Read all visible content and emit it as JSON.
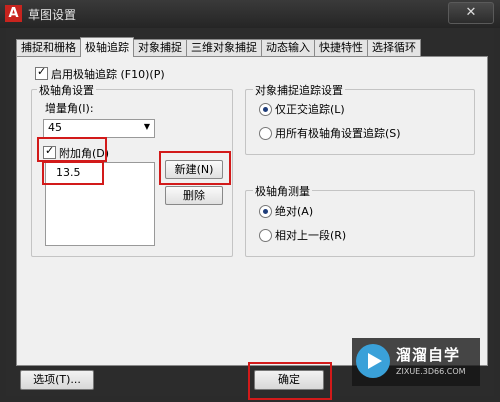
{
  "window": {
    "title": "草图设置",
    "logo_letter": "A",
    "close_label": "✕"
  },
  "tabs": [
    {
      "label": "捕捉和栅格"
    },
    {
      "label": "极轴追踪"
    },
    {
      "label": "对象捕捉"
    },
    {
      "label": "三维对象捕捉"
    },
    {
      "label": "动态输入"
    },
    {
      "label": "快捷特性"
    },
    {
      "label": "选择循环"
    }
  ],
  "active_tab": "极轴追踪",
  "enable_polar": {
    "label": "启用极轴追踪 (F10)(P)",
    "checked": true
  },
  "polar_settings": {
    "legend": "极轴角设置",
    "increment_label": "增量角(I):",
    "increment_value": "45",
    "additional_label": "附加角(D)",
    "additional_checked": true,
    "additional_angles": [
      "13.5"
    ],
    "new_button": "新建(N)",
    "delete_button": "删除"
  },
  "object_snap_tracking": {
    "legend": "对象捕捉追踪设置",
    "options": [
      {
        "label": "仅正交追踪(L)",
        "selected": true
      },
      {
        "label": "用所有极轴角设置追踪(S)",
        "selected": false
      }
    ]
  },
  "polar_measurement": {
    "legend": "极轴角测量",
    "options": [
      {
        "label": "绝对(A)",
        "selected": true
      },
      {
        "label": "相对上一段(R)",
        "selected": false
      }
    ]
  },
  "footer": {
    "options_button": "选项(T)...",
    "ok_button": "确定"
  },
  "watermark": {
    "title": "溜溜自学",
    "url": "ZIXUE.3D66.COM"
  },
  "colors": {
    "highlight": "#d21a1a",
    "dialog_bg": "#f0f0f0",
    "frame": "#2b2b2b"
  }
}
